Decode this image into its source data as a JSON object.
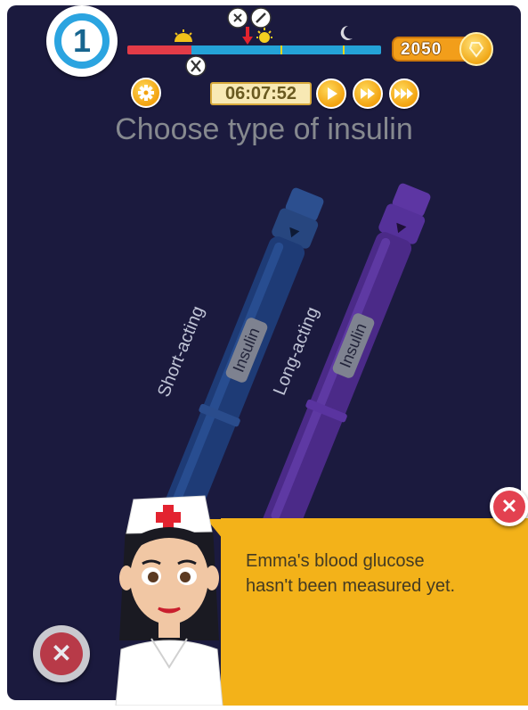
{
  "hud": {
    "level": "1",
    "coins": "2050",
    "clock": "06:07:52",
    "icons": {
      "settings": "gear-icon",
      "play": "play-icon",
      "fast_forward": "fast-forward-icon",
      "fastest_forward": "fastest-forward-icon",
      "timeline_sun": "sunrise-icon",
      "timeline_afternoon": "sun-icon",
      "timeline_moon": "moon-icon",
      "meal": "fork-knife-icon",
      "insulin_marker": "syringe-icon",
      "now_marker": "red-arrow-icon"
    }
  },
  "screen": {
    "title": "Choose type of insulin"
  },
  "pens": [
    {
      "type_label": "Short-acting",
      "name_label": "Insulin",
      "color": "#1d3a73"
    },
    {
      "type_label": "Long-acting",
      "name_label": "Insulin",
      "color": "#4b2a88"
    }
  ],
  "dialog": {
    "speaker": "nurse",
    "message_line1": "Emma's blood glucose",
    "message_line2": "hasn't been measured yet."
  },
  "colors": {
    "background": "#1b1a3e",
    "accent": "#f3b219",
    "close": "#e34150",
    "timeline_past": "#e33b47",
    "timeline_future": "#24a3d8"
  }
}
